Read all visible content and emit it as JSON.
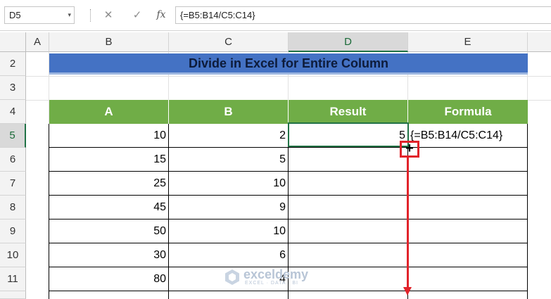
{
  "formula_bar": {
    "name_box": "D5",
    "dropdown_glyph": "▾",
    "cancel_glyph": "✕",
    "enter_glyph": "✓",
    "fx_label": "fx",
    "formula": "{=B5:B14/C5:C14}"
  },
  "columns": [
    "A",
    "B",
    "C",
    "D",
    "E"
  ],
  "rows": [
    "2",
    "3",
    "4",
    "5",
    "6",
    "7",
    "8",
    "9",
    "10",
    "11"
  ],
  "title": "Divide in Excel for Entire Column",
  "table": {
    "headers": [
      "A",
      "B",
      "Result",
      "Formula"
    ],
    "rows": [
      {
        "a": "10",
        "b": "2",
        "result": "5",
        "formula": "{=B5:B14/C5:C14}"
      },
      {
        "a": "15",
        "b": "5",
        "result": "",
        "formula": ""
      },
      {
        "a": "25",
        "b": "10",
        "result": "",
        "formula": ""
      },
      {
        "a": "45",
        "b": "9",
        "result": "",
        "formula": ""
      },
      {
        "a": "50",
        "b": "10",
        "result": "",
        "formula": ""
      },
      {
        "a": "30",
        "b": "6",
        "result": "",
        "formula": ""
      },
      {
        "a": "80",
        "b": "4",
        "result": "",
        "formula": ""
      }
    ]
  },
  "fill_handle_glyph": "+",
  "watermark": {
    "name": "exceldemy",
    "sub": "EXCEL · DATA · BI"
  },
  "colors": {
    "title_bg": "#4472c4",
    "header_bg": "#70ad47",
    "selection": "#217346",
    "annotation": "#e1232a"
  }
}
